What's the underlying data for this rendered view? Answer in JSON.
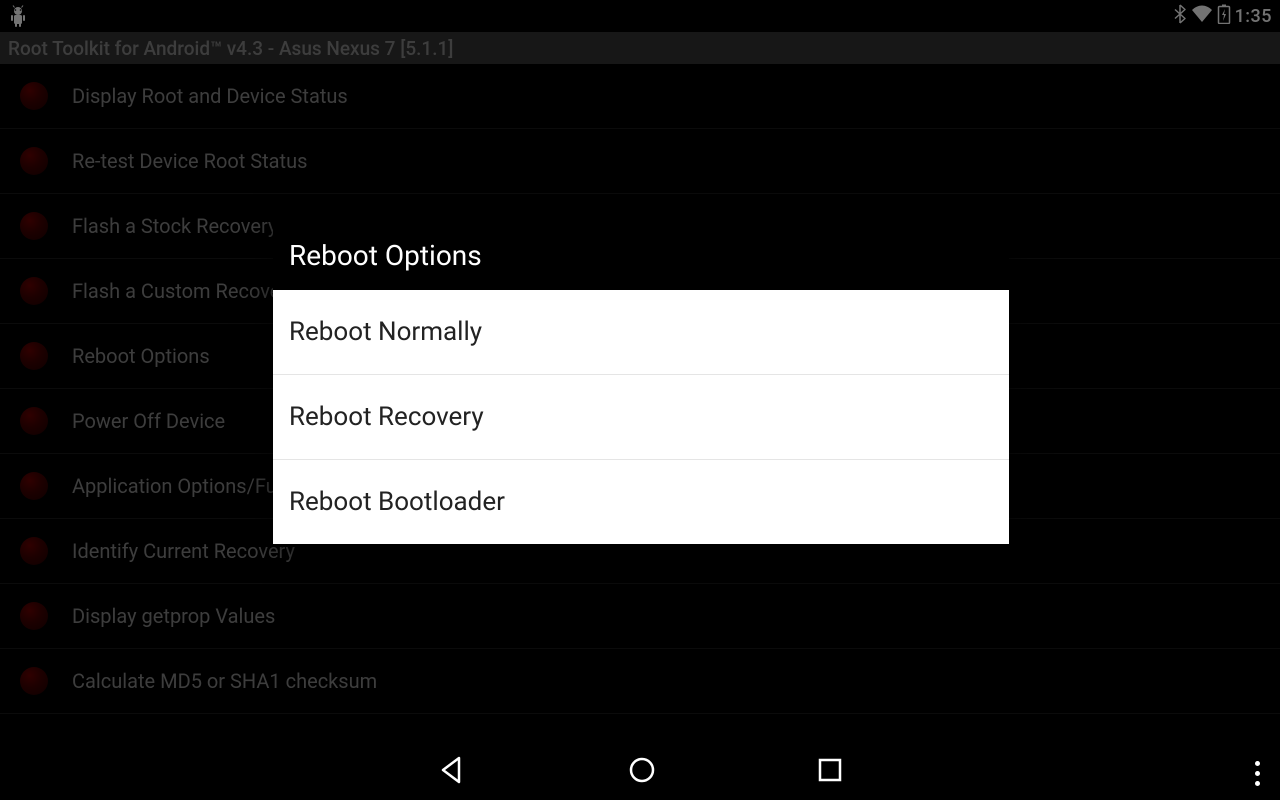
{
  "statusBar": {
    "time": "1:35"
  },
  "appTitle": "Root Toolkit for Android™ v4.3 - Asus Nexus 7 [5.1.1]",
  "menuItems": [
    "Display Root and Device Status",
    "Re-test Device Root Status",
    "Flash a Stock Recovery",
    "Flash a Custom Recovery",
    "Reboot Options",
    "Power Off Device",
    "Application Options/Functions",
    "Identify Current Recovery",
    "Display getprop Values",
    "Calculate MD5 or SHA1 checksum"
  ],
  "dialog": {
    "title": "Reboot Options",
    "options": [
      "Reboot Normally",
      "Reboot Recovery",
      "Reboot Bootloader"
    ]
  }
}
